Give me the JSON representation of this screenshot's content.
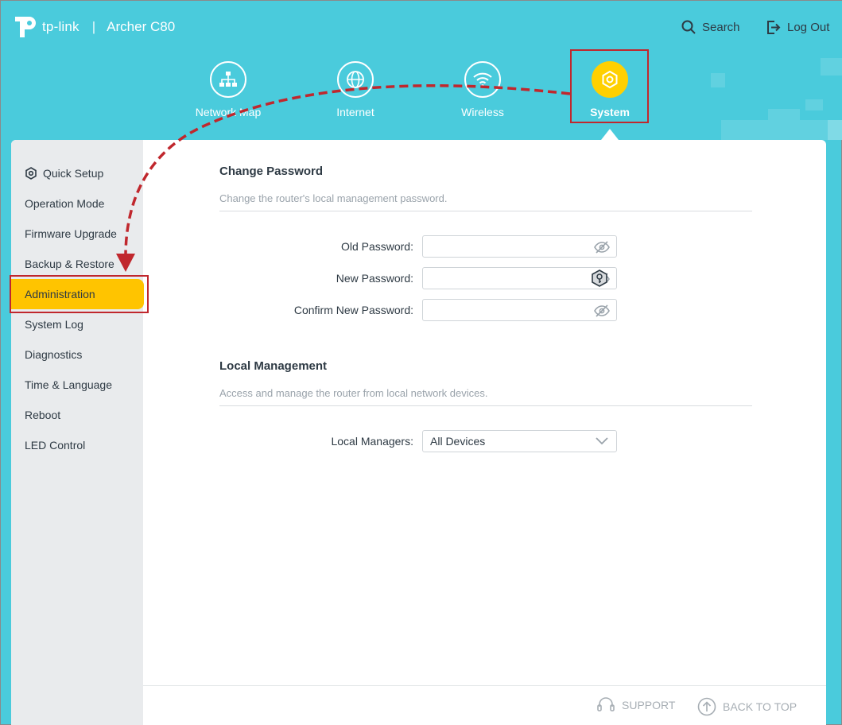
{
  "header": {
    "brand": "tp-link",
    "separator": "|",
    "model": "Archer C80",
    "search_label": "Search",
    "logout_label": "Log Out",
    "search_icon": "search-icon",
    "logout_icon": "logout-icon"
  },
  "nav": [
    {
      "label": "Network Map",
      "icon": "network-map-icon"
    },
    {
      "label": "Internet",
      "icon": "globe-icon"
    },
    {
      "label": "Wireless",
      "icon": "wifi-icon"
    },
    {
      "label": "System",
      "icon": "gear-icon",
      "active": true
    }
  ],
  "sidebar": {
    "items": [
      {
        "label": "Quick Setup",
        "icon": "gear-icon"
      },
      {
        "label": "Operation Mode"
      },
      {
        "label": "Firmware Upgrade"
      },
      {
        "label": "Backup & Restore"
      },
      {
        "label": "Administration",
        "active": true
      },
      {
        "label": "System Log"
      },
      {
        "label": "Diagnostics"
      },
      {
        "label": "Time & Language"
      },
      {
        "label": "Reboot"
      },
      {
        "label": "LED Control"
      }
    ]
  },
  "change_password": {
    "title": "Change Password",
    "description": "Change the router's local management password.",
    "old_label": "Old Password:",
    "new_label": "New Password:",
    "confirm_label": "Confirm New Password:",
    "old_value": "",
    "new_value": "",
    "confirm_value": ""
  },
  "local_management": {
    "title": "Local Management",
    "description": "Access and manage the router from local network devices.",
    "managers_label": "Local Managers:",
    "managers_value": "All Devices"
  },
  "footer": {
    "support_label": "SUPPORT",
    "back_to_top_label": "BACK TO TOP"
  },
  "colors": {
    "header_bg": "#4acbdc",
    "active_yellow": "#ffc400",
    "highlight_red": "#c0272d",
    "sidebar_bg": "#e9ebed"
  }
}
